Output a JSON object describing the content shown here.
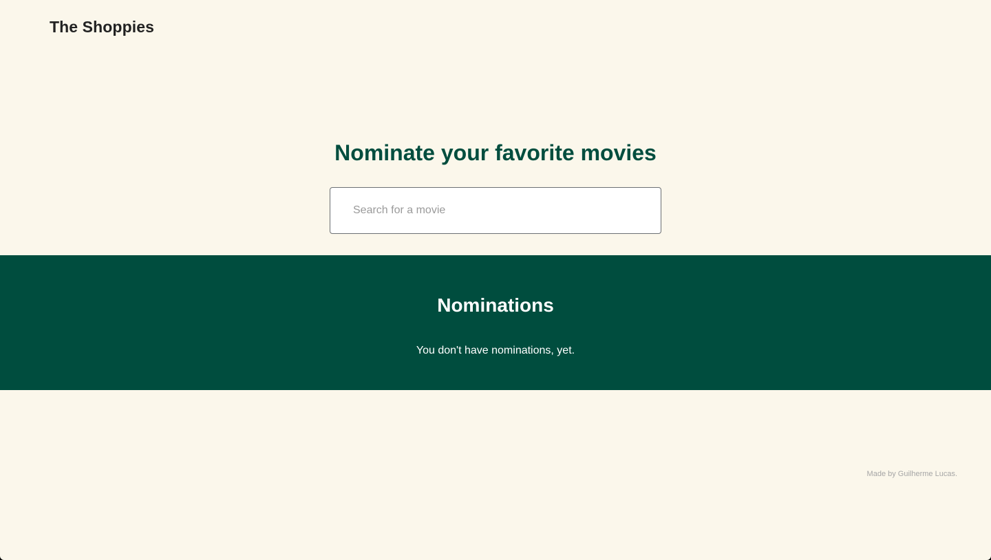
{
  "header": {
    "brand": "The Shoppies"
  },
  "hero": {
    "title": "Nominate your favorite movies",
    "search": {
      "placeholder": "Search for a movie",
      "value": ""
    }
  },
  "nominations": {
    "title": "Nominations",
    "empty_message": "You don't have nominations, yet."
  },
  "footer": {
    "credit": "Made by Guilherme Lucas."
  },
  "colors": {
    "background": "#fbf7eb",
    "accent": "#004d3e",
    "text_dark": "#222222",
    "text_light": "#ffffff"
  }
}
